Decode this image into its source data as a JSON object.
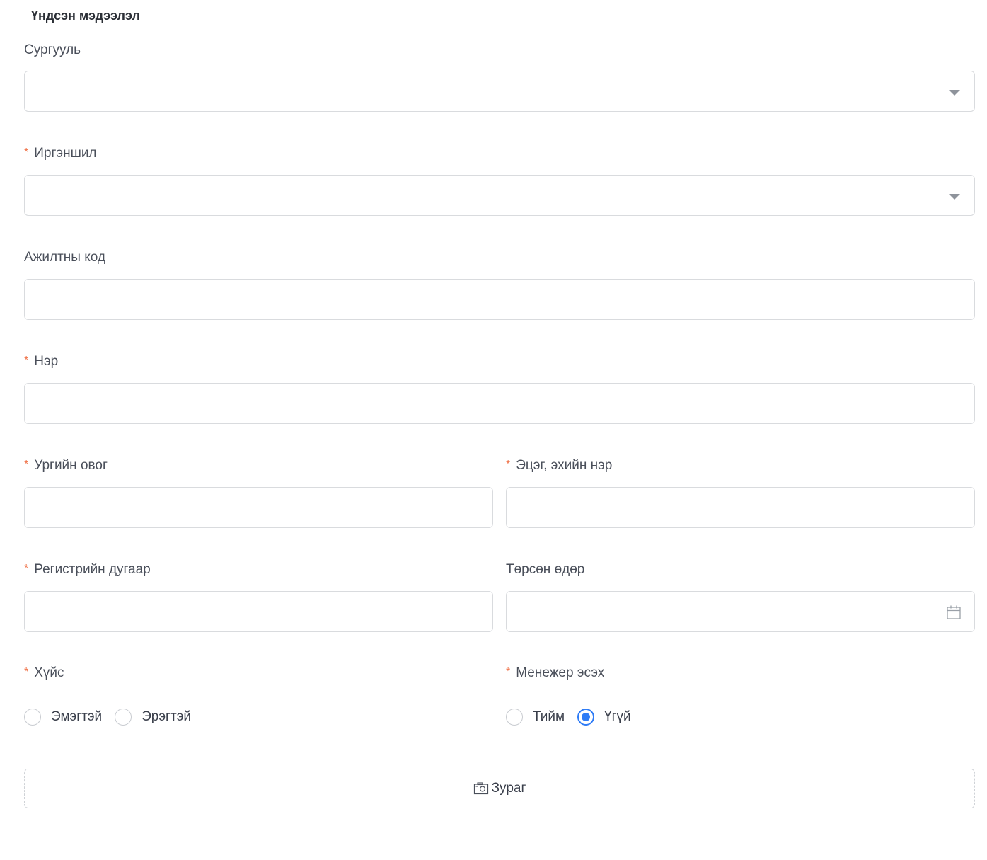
{
  "section": {
    "title": "Үндсэн мэдээлэл"
  },
  "fields": {
    "school": {
      "label": "Сургууль",
      "value": ""
    },
    "citizenship": {
      "label": "Иргэншил",
      "required_mark": "*",
      "value": ""
    },
    "employee_code": {
      "label": "Ажилтны код",
      "value": ""
    },
    "first_name": {
      "label": "Нэр",
      "required_mark": "*",
      "value": ""
    },
    "family_name": {
      "label": "Ургийн овог",
      "required_mark": "*",
      "value": ""
    },
    "parent_name": {
      "label": "Эцэг, эхийн нэр",
      "required_mark": "*",
      "value": ""
    },
    "register_number": {
      "label": "Регистрийн дугаар",
      "required_mark": "*",
      "value": ""
    },
    "birth_date": {
      "label": "Төрсөн өдөр",
      "value": "",
      "icon": "calendar-icon"
    },
    "gender": {
      "label": "Хүйс",
      "required_mark": "*",
      "options": [
        "Эмэгтэй",
        "Эрэгтэй"
      ],
      "selected": null
    },
    "is_manager": {
      "label": "Менежер эсэх",
      "required_mark": "*",
      "options": [
        "Тийм",
        "Үгүй"
      ],
      "selected": "Үгүй"
    }
  },
  "upload": {
    "label": "Зураг",
    "icon": "picture-icon"
  },
  "colors": {
    "required": "#f0734a",
    "accent": "#2f7cf6",
    "border": "#d9dbde"
  }
}
